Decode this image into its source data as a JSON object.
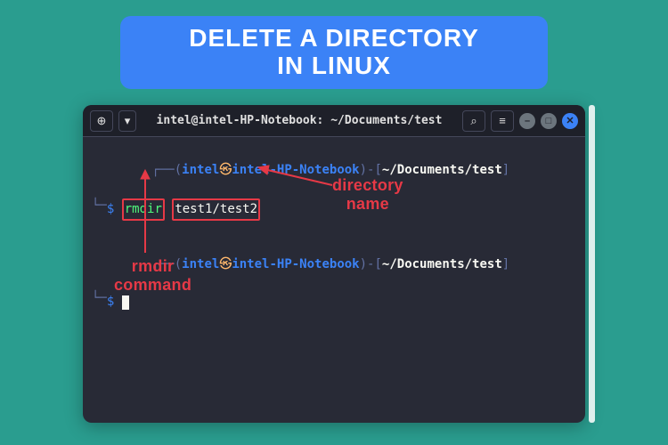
{
  "banner": {
    "line1": "DELETE A DIRECTORY",
    "line2": "IN LINUX"
  },
  "window": {
    "title": "intel@intel-HP-Notebook: ~/Documents/test",
    "new_tab_glyph": "⊕",
    "dropdown_glyph": "▾",
    "search_glyph": "⌕",
    "menu_glyph": "≡",
    "minimize_glyph": "–",
    "maximize_glyph": "□",
    "close_glyph": "✕"
  },
  "prompt": {
    "user": "intel",
    "at": "㉿",
    "host": "intel-HP-Notebook",
    "path": "~/Documents/test",
    "prefix": "┌──(",
    "suffix": ")-[",
    "close": "]",
    "line2_prefix": "└─",
    "sigil": "$"
  },
  "cmd": {
    "name": "rmdir",
    "arg": "test1/test2"
  },
  "annotations": {
    "rmdir_label": "rmdir\ncommand",
    "dirname_label": "directory\nname"
  }
}
